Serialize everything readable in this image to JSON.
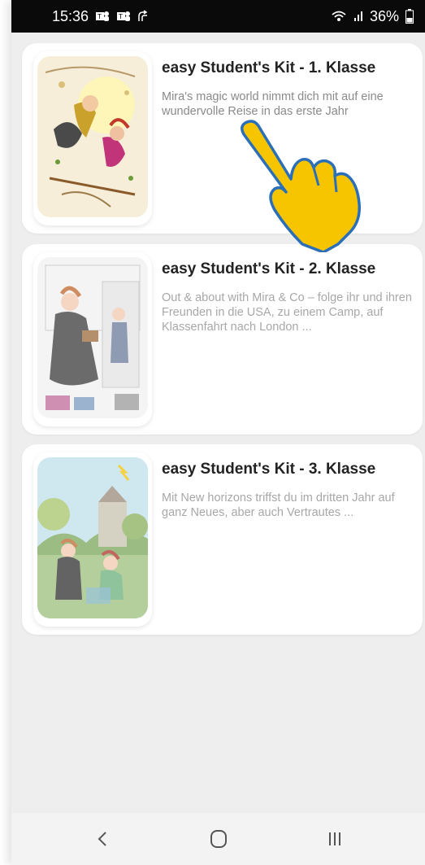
{
  "status_bar": {
    "time": "15:36",
    "battery": "36%",
    "left_icons": [
      "teams-icon",
      "teams-icon",
      "signal-arrow-icon"
    ],
    "right_icons": [
      "wifi-icon",
      "cell-signal-icon",
      "battery-icon"
    ]
  },
  "cards": [
    {
      "title": "easy Student's Kit - 1. Klasse",
      "description": "Mira's magic world nimmt dich mit auf eine wundervolle Reise in das erste Jahr"
    },
    {
      "title": "easy Student's Kit - 2. Klasse",
      "description": "Out & about with Mira & Co – folge ihr und ihren Freunden in die USA, zu einem Camp, auf Klassenfahrt nach London ..."
    },
    {
      "title": "easy Student's Kit - 3. Klasse",
      "description": "Mit New horizons triffst du im dritten Jahr auf ganz Neues, aber auch Vertrautes ..."
    }
  ],
  "nav": {
    "buttons": [
      "back-icon",
      "home-icon",
      "recents-icon"
    ]
  },
  "colors": {
    "background": "#eeeeee",
    "card": "#ffffff",
    "title": "#222222",
    "description": "#8a8a8a",
    "hand_fill": "#f7c500",
    "hand_stroke": "#2b6fb8"
  }
}
